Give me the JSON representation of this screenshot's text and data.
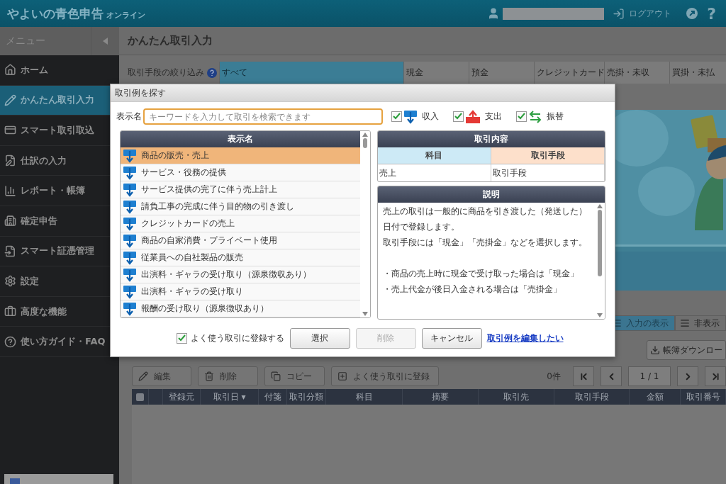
{
  "header": {
    "logo_main": "やよいの青色申告",
    "logo_sub": "オンライン",
    "logout": "ログアウト",
    "help": "?"
  },
  "sidebar": {
    "title": "メニュー",
    "items": [
      {
        "label": "ホーム",
        "selected": false
      },
      {
        "label": "かんたん取引入力",
        "selected": true
      },
      {
        "label": "スマート取引取込",
        "selected": false
      },
      {
        "label": "仕訳の入力",
        "selected": false
      },
      {
        "label": "レポート・帳簿",
        "selected": false
      },
      {
        "label": "確定申告",
        "selected": false
      },
      {
        "label": "スマート証憑管理",
        "selected": false
      },
      {
        "label": "設定",
        "selected": false
      },
      {
        "label": "高度な機能",
        "selected": false
      },
      {
        "label": "使い方ガイド・FAQ",
        "selected": false
      }
    ]
  },
  "page_title": "かんたん取引入力",
  "filter": {
    "label": "取引手段の絞り込み",
    "tabs": [
      {
        "label": "すべて",
        "selected": true
      },
      {
        "label": "現金",
        "selected": false
      },
      {
        "label": "預金",
        "selected": false
      },
      {
        "label": "クレジットカード",
        "selected": false
      },
      {
        "label": "売掛・未収",
        "selected": false
      },
      {
        "label": "買掛・未払",
        "selected": false
      }
    ]
  },
  "view_toggle": [
    {
      "label": "入力の表示",
      "selected": true
    },
    {
      "label": "非表示",
      "selected": false
    }
  ],
  "download_button": "帳簿ダウンロー",
  "toolbar": [
    {
      "label": "編集",
      "kind": "edit"
    },
    {
      "label": "削除",
      "kind": "delete"
    },
    {
      "label": "コピー",
      "kind": "copy"
    },
    {
      "label": "よく使う取引に登録",
      "kind": "favorite"
    }
  ],
  "count": "0件",
  "pager": "1 / 1",
  "table": {
    "select_all_checked": false,
    "columns": [
      "登録元",
      "取引日 ▾",
      "付箋",
      "取引分類",
      "科目",
      "摘要",
      "取引先",
      "取引手段",
      "金額",
      "取引番号"
    ]
  },
  "dialog": {
    "title": "取引例を探す",
    "search_label": "表示名",
    "search": {
      "placeholder": "キーワードを入力して取引を検索できます"
    },
    "filters": [
      {
        "label": "収入",
        "checked": true,
        "kind": "income"
      },
      {
        "label": "支出",
        "checked": true,
        "kind": "expense"
      },
      {
        "label": "振替",
        "checked": true,
        "kind": "transfer"
      }
    ],
    "list_header": "表示名",
    "list": [
      {
        "label": "商品の販売・売上",
        "selected": true,
        "kind": "income"
      },
      {
        "label": "サービス・役務の提供",
        "selected": false,
        "kind": "income"
      },
      {
        "label": "サービス提供の完了に伴う売上計上",
        "selected": false,
        "kind": "income"
      },
      {
        "label": "請負工事の完成に伴う目的物の引き渡し",
        "selected": false,
        "kind": "income"
      },
      {
        "label": "クレジットカードの売上",
        "selected": false,
        "kind": "income"
      },
      {
        "label": "商品の自家消費・プライベート使用",
        "selected": false,
        "kind": "income"
      },
      {
        "label": "従業員への自社製品の販売",
        "selected": false,
        "kind": "income"
      },
      {
        "label": "出演料・ギャラの受け取り（源泉徴収あり）",
        "selected": false,
        "kind": "income"
      },
      {
        "label": "出演料・ギャラの受け取り",
        "selected": false,
        "kind": "income"
      },
      {
        "label": "報酬の受け取り（源泉徴収あり）",
        "selected": false,
        "kind": "income"
      }
    ],
    "detail": {
      "header": "取引内容",
      "account_label": "科目",
      "method_label": "取引手段",
      "account": "売上",
      "method": "取引手段"
    },
    "explain": {
      "header": "説明",
      "groups": [
        [
          "売上の取引は一般的に商品を引き渡した（発送した）日付で登録します。",
          "取引手段には「現金」「売掛金」などを選択します。"
        ],
        [
          "・商品の売上時に現金で受け取った場合は「現金」",
          "・売上代金が後日入金される場合は「売掛金」"
        ]
      ]
    },
    "register": {
      "label": "よく使う取引に登録する",
      "checked": true
    },
    "buttons": [
      {
        "label": "選択",
        "disabled": false
      },
      {
        "label": "削除",
        "disabled": true
      },
      {
        "label": "キャンセル",
        "disabled": false
      }
    ],
    "link": "取引例を編集したい"
  }
}
